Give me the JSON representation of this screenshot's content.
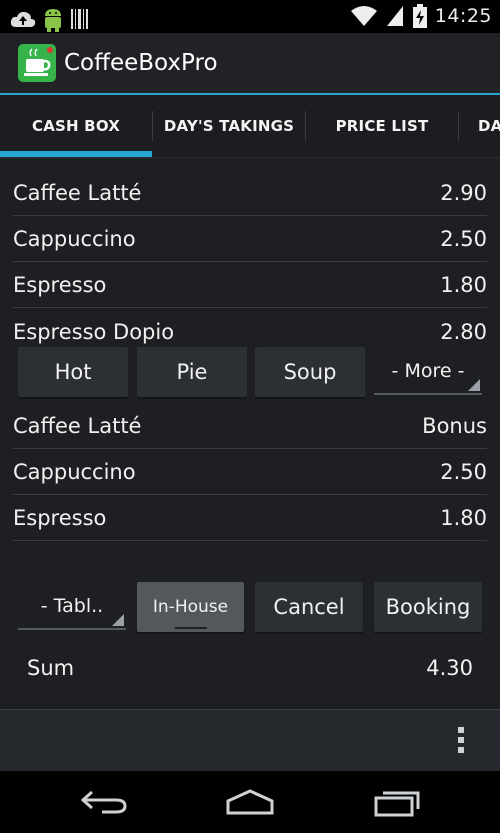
{
  "status_bar": {
    "time": "14:25",
    "icons": [
      "cloud-upload-icon",
      "android-icon",
      "barcode-icon",
      "wifi-icon",
      "signal-icon",
      "battery-charging-icon"
    ]
  },
  "app": {
    "title": "CoffeeBoxPro",
    "icon": "coffee-cup-icon",
    "accent": "#27a3d6"
  },
  "tabs": [
    {
      "label": "CASH BOX",
      "selected": true
    },
    {
      "label": "DAY'S TAKINGS",
      "selected": false
    },
    {
      "label": "PRICE LIST",
      "selected": false
    },
    {
      "label": "DA",
      "selected": false
    }
  ],
  "product_list": [
    {
      "name": "Caffee Latté",
      "price": "2.90"
    },
    {
      "name": "Cappuccino",
      "price": "2.50"
    },
    {
      "name": "Espresso",
      "price": "1.80"
    },
    {
      "name": "Espresso Dopio",
      "price": "2.80"
    }
  ],
  "categories": [
    "Hot",
    "Pie",
    "Soup"
  ],
  "more_spinner": {
    "value": "- More -"
  },
  "order_list": [
    {
      "name": "Caffee Latté",
      "price": "Bonus"
    },
    {
      "name": "Cappuccino",
      "price": "2.50"
    },
    {
      "name": "Espresso",
      "price": "1.80"
    }
  ],
  "table_spinner": {
    "value": "- Tabl.."
  },
  "actions": {
    "in_house": "In-House",
    "cancel": "Cancel",
    "booking": "Booking"
  },
  "sum": {
    "label": "Sum",
    "value": "4.30"
  },
  "nav": [
    "back-icon",
    "home-icon",
    "recent-apps-icon"
  ]
}
